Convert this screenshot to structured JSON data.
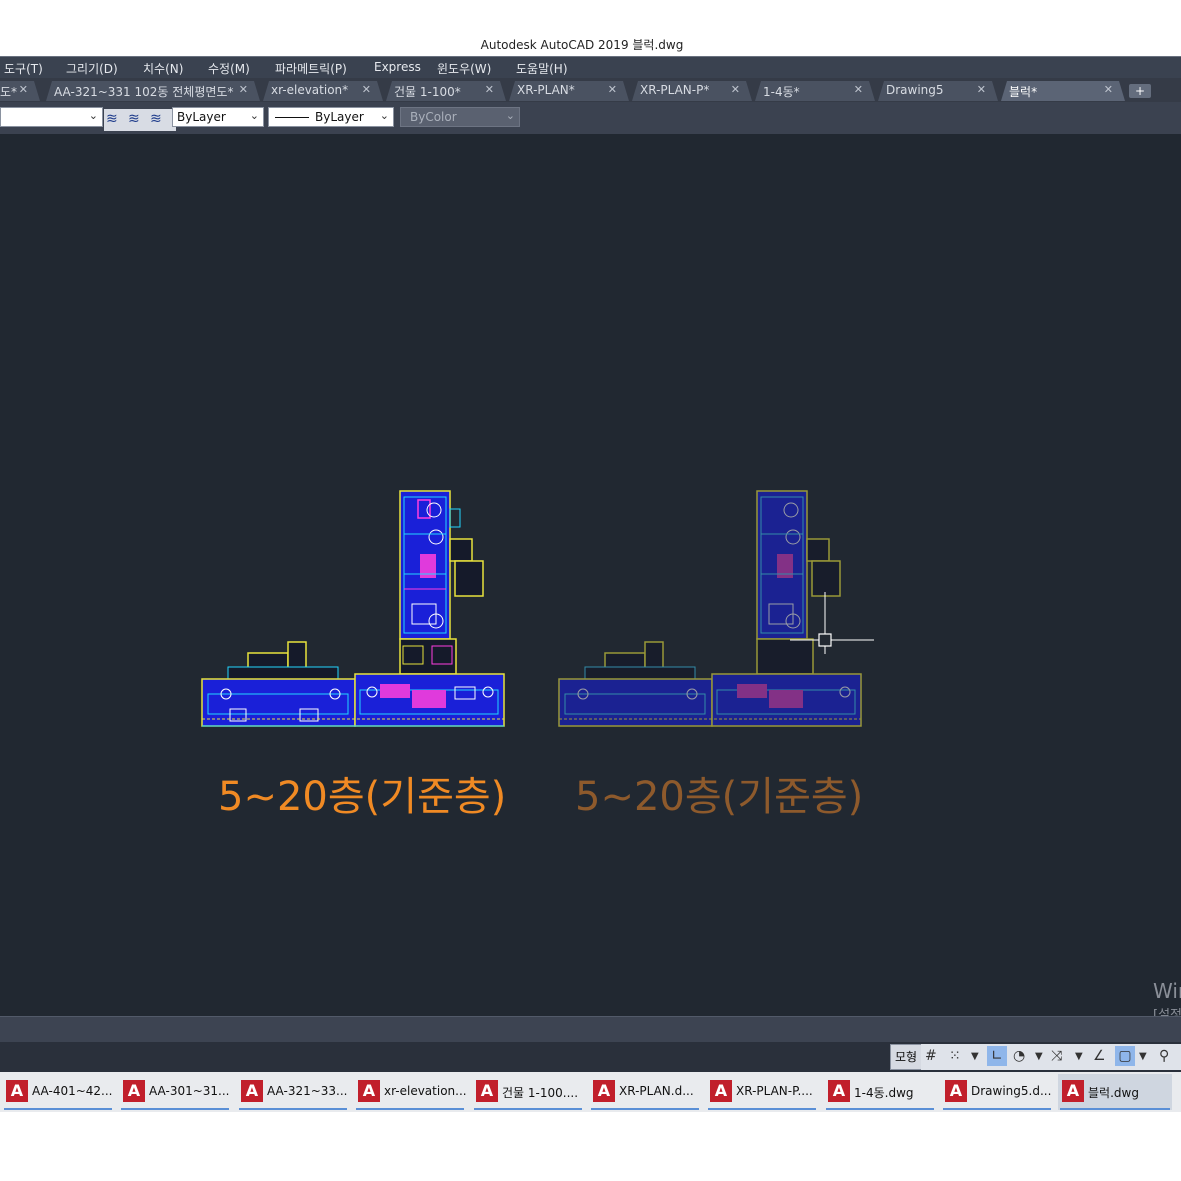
{
  "window": {
    "title": "Autodesk AutoCAD 2019    블럭.dwg"
  },
  "menu": [
    "도구(T)",
    "그리기(D)",
    "치수(N)",
    "수정(M)",
    "파라메트릭(P)",
    "Express",
    "윈도우(W)",
    "도움말(H)"
  ],
  "tabs": [
    {
      "label": "도*"
    },
    {
      "label": "AA-321~331 102동 전체평면도*"
    },
    {
      "label": "xr-elevation*"
    },
    {
      "label": "건물 1-100*"
    },
    {
      "label": "XR-PLAN*"
    },
    {
      "label": "XR-PLAN-P*"
    },
    {
      "label": "1-4동*"
    },
    {
      "label": "Drawing5"
    },
    {
      "label": "블럭*",
      "active": true
    }
  ],
  "tab_add_label": "+",
  "properties": {
    "layer_value": "",
    "color_value": "ByLayer",
    "linetype_value": "ByLayer",
    "lineweight_value": "ByColor"
  },
  "canvas": {
    "background": "#212831",
    "label_left": "5~20층(기준층)",
    "label_left_color": "#f08a24",
    "label_right": "5~20층(기준층)",
    "label_right_color": "#8e5a2c",
    "watermark_line1": "Wir",
    "watermark_line2": "[설정"
  },
  "statusbar": {
    "model_label": "모형"
  },
  "taskbar": [
    {
      "label": "AA-401~42..."
    },
    {
      "label": "AA-301~31..."
    },
    {
      "label": "AA-321~33..."
    },
    {
      "label": "xr-elevation..."
    },
    {
      "label": "건물 1-100...."
    },
    {
      "label": "XR-PLAN.d..."
    },
    {
      "label": "XR-PLAN-P...."
    },
    {
      "label": "1-4동.dwg"
    },
    {
      "label": "Drawing5.d..."
    },
    {
      "label": "블럭.dwg",
      "active": true
    }
  ]
}
